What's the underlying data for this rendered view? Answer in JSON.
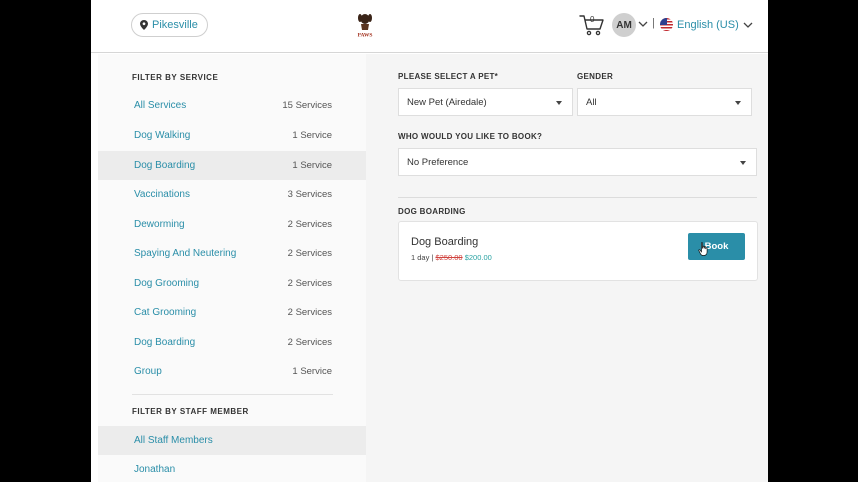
{
  "header": {
    "location": "Pikesville",
    "logo_text": "PAWS",
    "cart_count": "0",
    "avatar_initials": "AM",
    "separator": "|",
    "language": "English (US)"
  },
  "sidebar": {
    "service_filter_title": "FILTER BY SERVICE",
    "services": [
      {
        "name": "All Services",
        "count": "15 Services"
      },
      {
        "name": "Dog Walking",
        "count": "1 Service"
      },
      {
        "name": "Dog Boarding",
        "count": "1 Service",
        "active": true
      },
      {
        "name": "Vaccinations",
        "count": "3 Services"
      },
      {
        "name": "Deworming",
        "count": "2 Services"
      },
      {
        "name": "Spaying And Neutering",
        "count": "2 Services"
      },
      {
        "name": "Dog Grooming",
        "count": "2 Services"
      },
      {
        "name": "Cat Grooming",
        "count": "2 Services"
      },
      {
        "name": "Dog Boarding",
        "count": "2 Services"
      },
      {
        "name": "Group",
        "count": "1 Service"
      }
    ],
    "staff_filter_title": "FILTER BY STAFF MEMBER",
    "staff": [
      {
        "name": "All Staff Members",
        "active": true
      },
      {
        "name": "Jonathan"
      }
    ]
  },
  "main": {
    "pet_label": "PLEASE SELECT A PET*",
    "pet_value": "New Pet (Airedale)",
    "gender_label": "GENDER",
    "gender_value": "All",
    "book_who_label": "WHO WOULD YOU LIKE TO BOOK?",
    "book_who_value": "No Preference",
    "section_title": "DOG BOARDING",
    "card": {
      "title": "Dog Boarding",
      "duration": "1 day |",
      "old_price": "$250.00",
      "new_price": "$200.00",
      "book_label": "Book"
    }
  },
  "colors": {
    "accent": "#2a8ea8",
    "old_price": "#d0433f",
    "new_price": "#2aa3a3"
  }
}
